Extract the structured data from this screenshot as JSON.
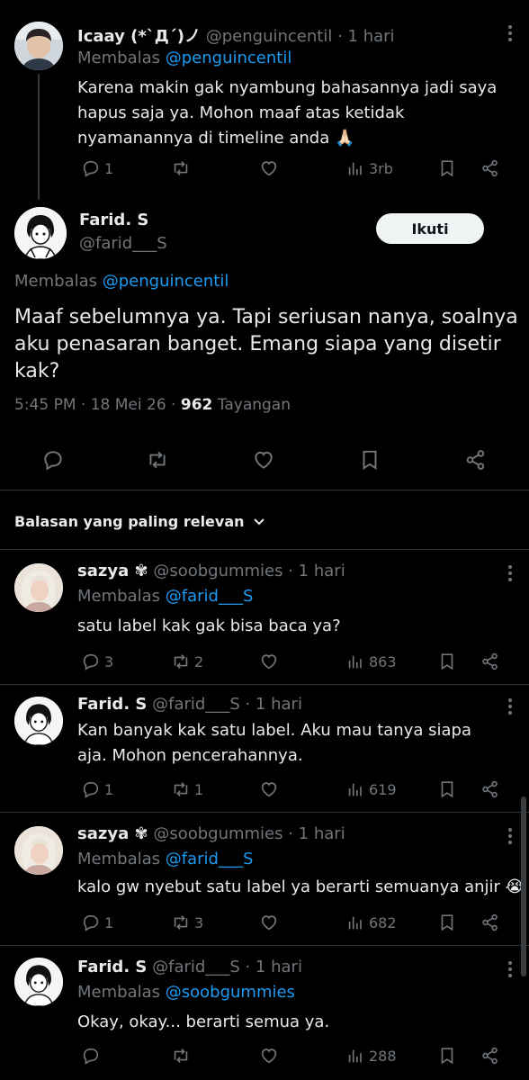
{
  "tweet1": {
    "name": "Icaay (*`Д´)ノ",
    "handle": "@penguincentil",
    "time": "· 1 hari",
    "replying_label": "Membalas",
    "replying_to": "@penguincentil",
    "text": "Karena makin gak nyambung bahasannya jadi saya hapus saja ya. Mohon maaf atas ketidak nyamanannya di timeline anda 🙏🏻",
    "replies": "1",
    "reposts": "",
    "views": "3rb"
  },
  "main_tweet": {
    "name": "Farid. S",
    "handle": "@farid___S",
    "follow_label": "Ikuti",
    "replying_label": "Membalas",
    "replying_to": "@penguincentil",
    "text": "Maaf sebelumnya ya. Tapi seriusan nanya, soalnya aku penasaran banget. Emang siapa yang disetir kak?",
    "timestamp": "5:45 PM · 18 Mei 26 ·",
    "view_count": "962",
    "views_label": "Tayangan"
  },
  "sort": {
    "label": "Balasan yang paling relevan"
  },
  "replies": [
    {
      "name": "sazya ✾",
      "handle": "@soobgummies",
      "time": "· 1 hari",
      "replying_label": "Membalas",
      "replying_to": "@farid___S",
      "text": "satu label kak gak bisa baca ya?",
      "replies": "3",
      "reposts": "2",
      "views": "863"
    },
    {
      "name": "Farid. S",
      "handle": "@farid___S",
      "time": "· 1 hari",
      "text": "Kan banyak kak satu label. Aku mau tanya siapa aja. Mohon pencerahannya.",
      "replies": "1",
      "reposts": "1",
      "views": "619"
    },
    {
      "name": "sazya ✾",
      "handle": "@soobgummies",
      "time": "· 1 hari",
      "replying_label": "Membalas",
      "replying_to": "@farid___S",
      "text": "kalo gw nyebut satu label ya berarti semuanya anjir 😭",
      "replies": "1",
      "reposts": "3",
      "views": "682"
    },
    {
      "name": "Farid. S",
      "handle": "@farid___S",
      "time": "· 1 hari",
      "replying_label": "Membalas",
      "replying_to": "@soobgummies",
      "text": "Okay, okay... berarti semua ya.",
      "replies": "",
      "reposts": "",
      "views": "288"
    }
  ],
  "colors": {
    "background": "#000000",
    "text": "#e7e9ea",
    "muted": "#71767b",
    "link": "#1d9bf0",
    "divider": "#2f3336"
  }
}
